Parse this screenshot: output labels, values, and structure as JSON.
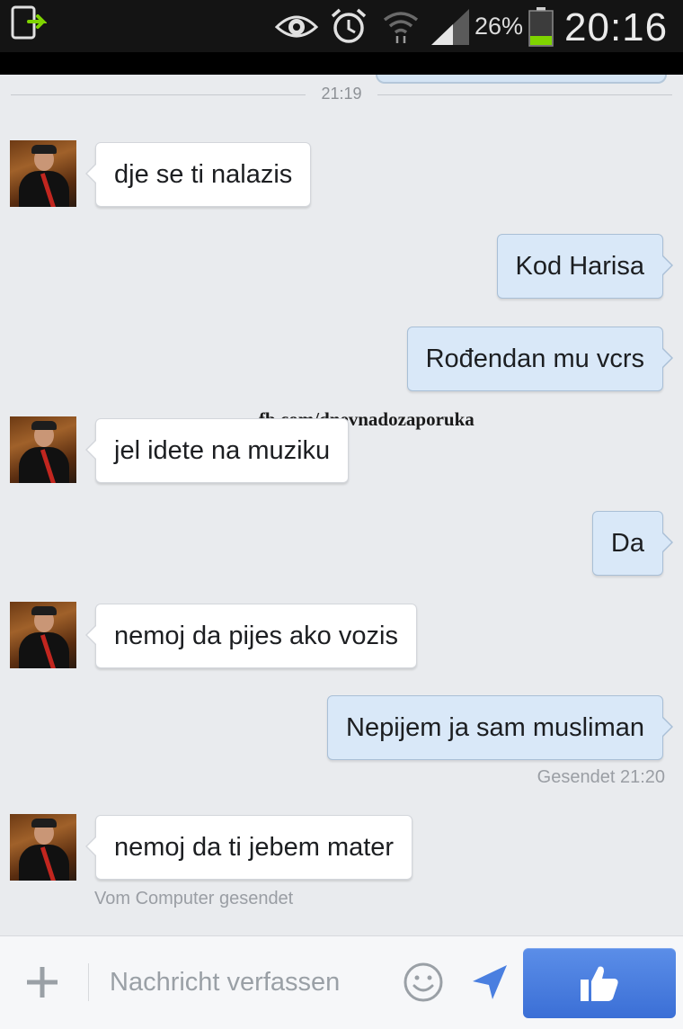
{
  "status_bar": {
    "battery_percent": "26%",
    "battery_level": 0.26,
    "time": "20:16",
    "icons": [
      "download-notification-icon",
      "eye-icon",
      "alarm-clock-icon",
      "wifi-icon",
      "signal-icon",
      "battery-icon"
    ]
  },
  "conversation": {
    "time_divider": "21:19",
    "messages": [
      {
        "direction": "in",
        "text": "dje se ti nalazis"
      },
      {
        "direction": "out",
        "text": "Kod Harisa"
      },
      {
        "direction": "out",
        "text": "Rođendan mu vcrs"
      },
      {
        "direction": "in",
        "text": "jel idete na muziku"
      },
      {
        "direction": "out",
        "text": "Da"
      },
      {
        "direction": "in",
        "text": "nemoj da pijes ako vozis"
      },
      {
        "direction": "out",
        "text": "Nepijem ja sam musliman"
      },
      {
        "direction": "in",
        "text": "nemoj da ti jebem mater"
      }
    ],
    "sent_status": "Gesendet 21:20",
    "sent_from": "Vom Computer gesendet",
    "watermark": "fb.com/dnevnadozaporuka"
  },
  "composer": {
    "placeholder": "Nachricht verfassen",
    "icons": [
      "plus-icon",
      "emoji-icon",
      "location-arrow-icon",
      "thumbs-up-icon"
    ],
    "colors": {
      "like_button": "#4a7fe0",
      "outgoing_bubble": "#d9e8f8",
      "background": "#e9ebee"
    }
  }
}
